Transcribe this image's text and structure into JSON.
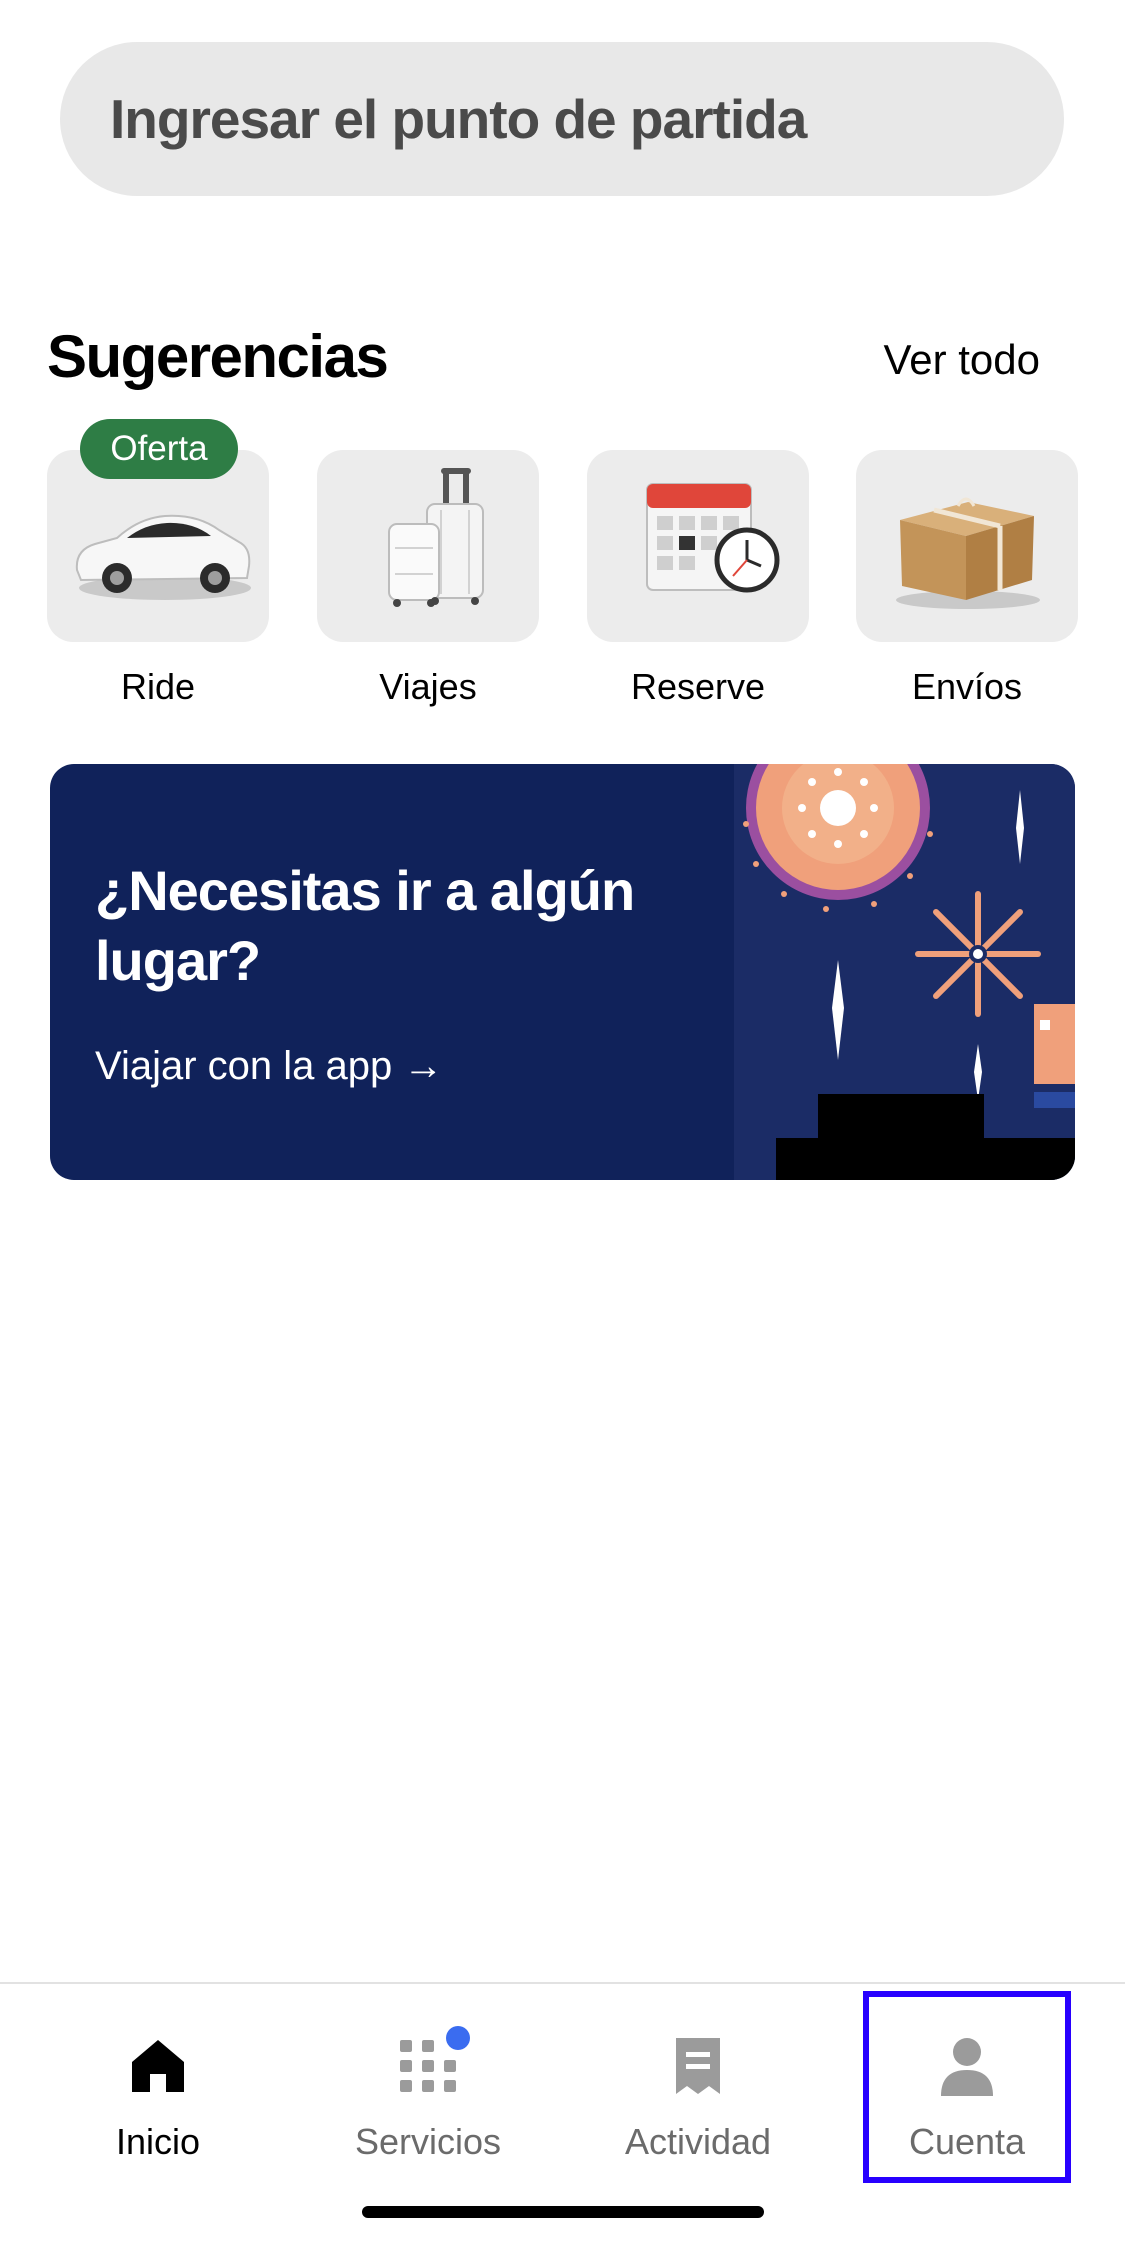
{
  "search": {
    "placeholder": "Ingresar el punto de partida"
  },
  "suggestions": {
    "title": "Sugerencias",
    "see_all": "Ver todo",
    "items": [
      {
        "label": "Ride",
        "icon": "car-icon",
        "badge": "Oferta"
      },
      {
        "label": "Viajes",
        "icon": "luggage-icon"
      },
      {
        "label": "Reserve",
        "icon": "calendar-clock-icon"
      },
      {
        "label": "Envíos",
        "icon": "package-icon"
      }
    ]
  },
  "banner": {
    "title": "¿Necesitas ir a algún lugar?",
    "cta": "Viajar con la app →"
  },
  "tabs": [
    {
      "label": "Inicio",
      "icon": "home-icon",
      "active": true
    },
    {
      "label": "Servicios",
      "icon": "grid-icon",
      "notification_dot": true
    },
    {
      "label": "Actividad",
      "icon": "receipt-icon"
    },
    {
      "label": "Cuenta",
      "icon": "person-icon",
      "highlighted": true
    }
  ],
  "colors": {
    "badge_green": "#2e7d45",
    "banner_bg": "#10225a",
    "highlight_outline": "#2800ff",
    "notification_dot": "#3a6cf0"
  }
}
